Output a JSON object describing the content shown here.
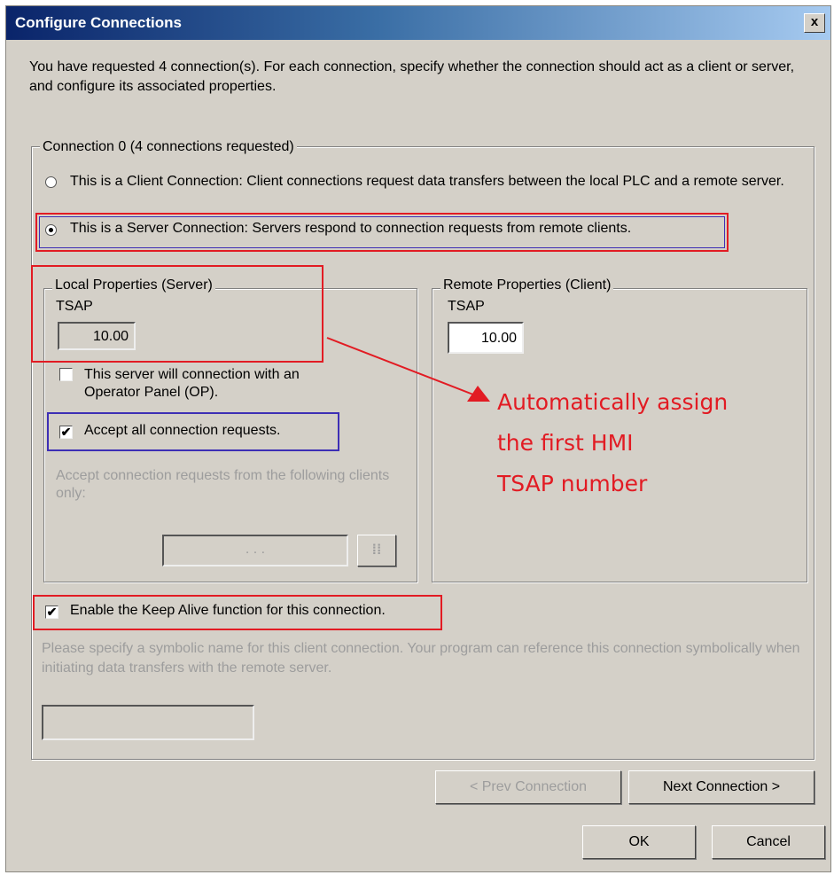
{
  "window": {
    "title": "Configure Connections",
    "close_glyph": "x"
  },
  "intro_text": "You have requested 4 connection(s). For each connection, specify whether the connection should act as a client or server, and configure its associated properties.",
  "connection_group": {
    "legend": "Connection 0 (4 connections requested)",
    "client_option": "This is a Client Connection: Client connections request data transfers between the local PLC and a remote server.",
    "server_option": "This is a Server Connection: Servers respond to connection requests from remote clients.",
    "selected": "server"
  },
  "local_properties": {
    "legend": "Local Properties (Server)",
    "tsap_label": "TSAP",
    "tsap_value": "10.00",
    "op_checkbox_label": "This server will connection with an Operator Panel (OP).",
    "op_checked": false,
    "accept_all_label": "Accept all connection requests.",
    "accept_all_checked": true,
    "accept_following_text": "Accept connection requests from the following clients only:",
    "ip_placeholder": ". . .",
    "ip_button_icon": "address-book-icon"
  },
  "remote_properties": {
    "legend": "Remote Properties (Client)",
    "tsap_label": "TSAP",
    "tsap_value": "10.00"
  },
  "keep_alive": {
    "label": "Enable the Keep Alive function for this connection.",
    "checked": true
  },
  "symbolic_name_text": "Please specify a symbolic name for this client connection. Your program can reference this connection symbolically when initiating data transfers with the remote server.",
  "symbolic_name_value": "",
  "buttons": {
    "prev": "< Prev Connection",
    "next": "Next Connection >",
    "ok": "OK",
    "cancel": "Cancel"
  },
  "annotation": {
    "line1": "Automatically assign",
    "line2": "the first HMI",
    "line3": "TSAP number",
    "color": "#e21b23"
  },
  "colors": {
    "highlight_red": "#e21b23",
    "highlight_blue": "#3d2fb5",
    "dialog_bg": "#d4d0c8"
  }
}
